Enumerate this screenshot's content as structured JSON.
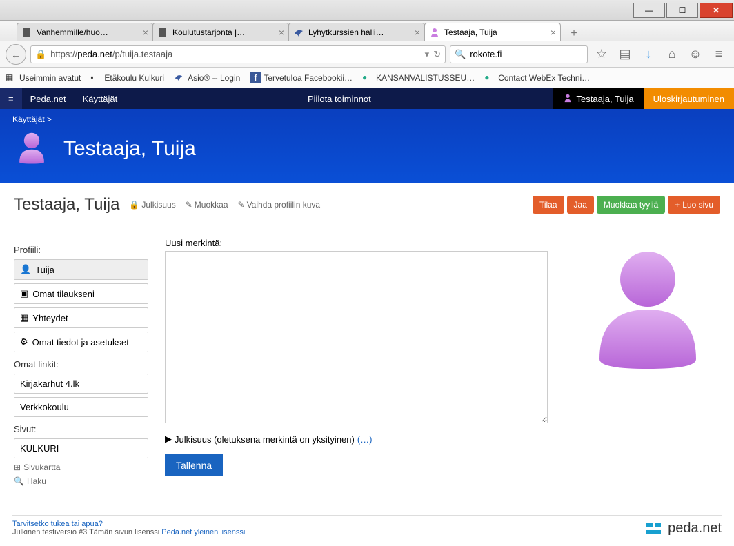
{
  "window": {
    "title": "Testaaja, Tuija"
  },
  "tabs": [
    {
      "label": "Vanhemmille/huo…",
      "active": false
    },
    {
      "label": "Koulutustarjonta |…",
      "active": false
    },
    {
      "label": "Lyhytkurssien halli…",
      "active": false
    },
    {
      "label": "Testaaja, Tuija",
      "active": true
    }
  ],
  "url": {
    "prefix": "https://",
    "domain": "peda.net",
    "path": "/p/tuija.testaaja"
  },
  "search": {
    "value": "rokote.fi"
  },
  "bookmarks": [
    "Useimmin avatut",
    "Etäkoulu Kulkuri",
    "Asio® -- Login",
    "Tervetuloa Facebookii…",
    "KANSANVALISTUSSEU…",
    "Contact WebEx Techni…"
  ],
  "pagenav": {
    "home": "Peda.net",
    "users": "Käyttäjät",
    "hide": "Piilota toiminnot",
    "user": "Testaaja, Tuija",
    "logout": "Uloskirjautuminen"
  },
  "breadcrumb": "Käyttäjät >",
  "hero_title": "Testaaja, Tuija",
  "page_title": "Testaaja, Tuija",
  "sublinks": {
    "visibility": "Julkisuus",
    "edit": "Muokkaa",
    "change_pic": "Vaihda profiilin kuva"
  },
  "buttons": {
    "subscribe": "Tilaa",
    "share": "Jaa",
    "edit_style": "Muokkaa tyyliä",
    "new_page": "Luo sivu",
    "save": "Tallenna"
  },
  "sidebar": {
    "profile_label": "Profiili:",
    "profile_items": [
      "Tuija",
      "Omat tilaukseni",
      "Yhteydet",
      "Omat tiedot ja asetukset"
    ],
    "links_label": "Omat linkit:",
    "links_items": [
      "Kirjakarhut 4.lk",
      "Verkkokoulu"
    ],
    "pages_label": "Sivut:",
    "pages_items": [
      "KULKURI"
    ],
    "sitemap": "Sivukartta",
    "search": "Haku"
  },
  "entry_label": "Uusi merkintä:",
  "disclosure": {
    "arrow": "▶",
    "text": "Julkisuus (oletuksena merkintä on yksityinen)",
    "more": "(…)"
  },
  "footer": {
    "support": "Tarvitsetko tukea tai apua?",
    "license_prefix": "Julkinen testiversio #3 Tämän sivun lisenssi ",
    "license_link": "Peda.net yleinen lisenssi",
    "brand": "peda.net"
  }
}
